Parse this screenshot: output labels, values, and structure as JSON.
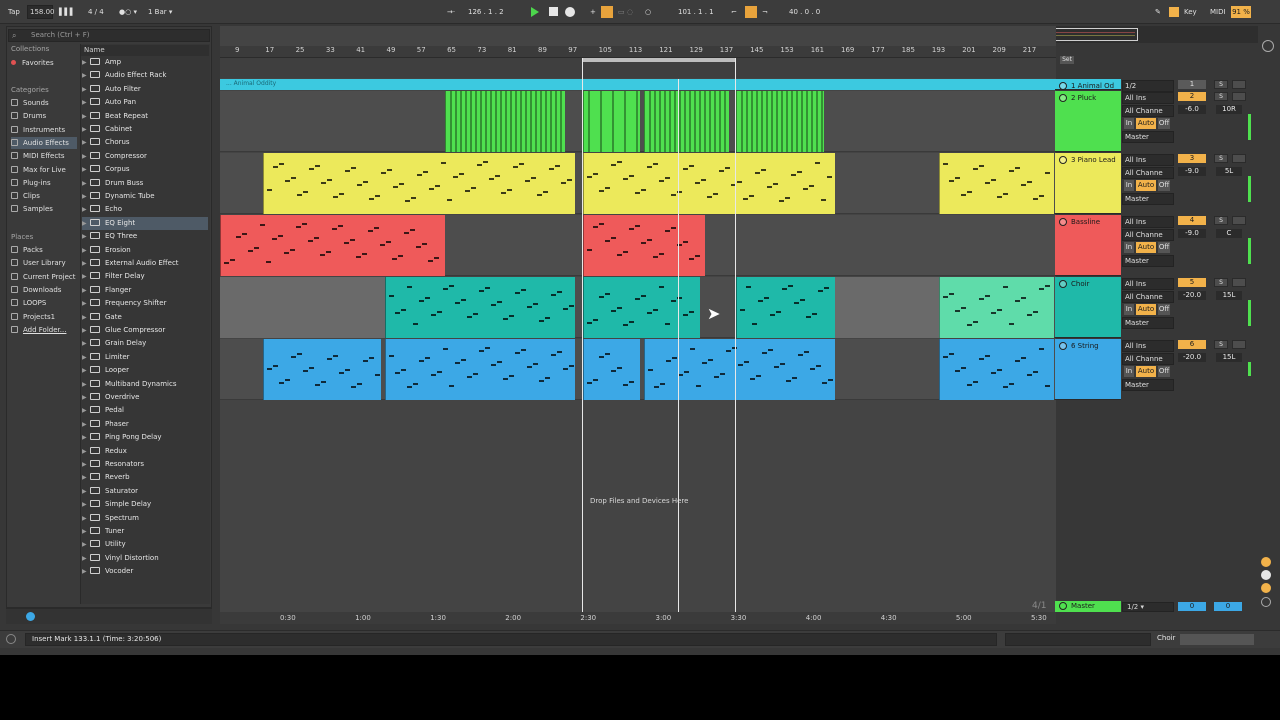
{
  "transport": {
    "tap": "Tap",
    "tempo": "158.00",
    "meter": "4 / 4",
    "quant": "1 Bar",
    "position": "126 .  1 .  2",
    "loop_start": "101 .  1 .  1",
    "loop_len": "40 .  0 .  0",
    "key": "Key",
    "midi": "MIDI",
    "cpu": "91 %"
  },
  "browser": {
    "search_placeholder": "Search (Ctrl + F)",
    "collections_header": "Collections",
    "favorites": "Favorites",
    "categories_header": "Categories",
    "categories": [
      "Sounds",
      "Drums",
      "Instruments",
      "Audio Effects",
      "MIDI Effects",
      "Max for Live",
      "Plug-ins",
      "Clips",
      "Samples"
    ],
    "places_header": "Places",
    "places": [
      "Packs",
      "User Library",
      "Current Project",
      "Downloads",
      "LOOPS",
      "Projects1",
      "Add Folder..."
    ],
    "name_header": "Name",
    "items": [
      "Amp",
      "Audio Effect Rack",
      "Auto Filter",
      "Auto Pan",
      "Beat Repeat",
      "Cabinet",
      "Chorus",
      "Compressor",
      "Corpus",
      "Drum Buss",
      "Dynamic Tube",
      "Echo",
      "EQ Eight",
      "EQ Three",
      "Erosion",
      "External Audio Effect",
      "Filter Delay",
      "Flanger",
      "Frequency Shifter",
      "Gate",
      "Glue Compressor",
      "Grain Delay",
      "Limiter",
      "Looper",
      "Multiband Dynamics",
      "Overdrive",
      "Pedal",
      "Phaser",
      "Ping Pong Delay",
      "Redux",
      "Resonators",
      "Reverb",
      "Saturator",
      "Simple Delay",
      "Spectrum",
      "Tuner",
      "Utility",
      "Vinyl Distortion",
      "Vocoder"
    ]
  },
  "ruler": {
    "bars": [
      "9",
      "17",
      "25",
      "33",
      "41",
      "49",
      "57",
      "65",
      "73",
      "81",
      "89",
      "97",
      "105",
      "113",
      "121",
      "129",
      "137",
      "145",
      "153",
      "161",
      "169",
      "177",
      "185",
      "193",
      "201",
      "209",
      "217"
    ],
    "times": [
      "0:30",
      "1:00",
      "1:30",
      "2:00",
      "2:30",
      "3:00",
      "3:30",
      "4:00",
      "4:30",
      "5:00",
      "5:30"
    ],
    "set_label": "Set"
  },
  "group_clip_label": "... Animal Oddity",
  "drop_hint": "Drop Files and Devices Here",
  "tracks": [
    {
      "name": "1 Animal Od",
      "io_in": "1/2",
      "num": "1",
      "vol": "",
      "pan": "",
      "color": "#3cc9e0"
    },
    {
      "name": "2 Pluck",
      "io_in": "All Ins",
      "io_ch": "All Channe",
      "io_out": "Master",
      "num": "2",
      "vol": "-6.0",
      "pan": "10R",
      "color": "#4fe04f"
    },
    {
      "name": "3 Piano Lead",
      "io_in": "All Ins",
      "io_ch": "All Channe",
      "io_out": "Master",
      "num": "3",
      "vol": "-9.0",
      "pan": "5L",
      "color": "#ece95b"
    },
    {
      "name": "Bassline",
      "io_in": "All Ins",
      "io_ch": "All Channe",
      "io_out": "Master",
      "num": "4",
      "vol": "-9.0",
      "pan": "C",
      "color": "#ef5a5a"
    },
    {
      "name": "Choir",
      "io_in": "All Ins",
      "io_ch": "All Channe",
      "io_out": "Master",
      "num": "5",
      "vol": "-20.0",
      "pan": "15L",
      "color": "#1fb9a9"
    },
    {
      "name": "6 String",
      "io_in": "All Ins",
      "io_ch": "All Channe",
      "io_out": "Master",
      "num": "6",
      "vol": "-20.0",
      "pan": "15L",
      "color": "#3ca8e6"
    }
  ],
  "io_labels": {
    "in": "In",
    "auto": "Auto",
    "off": "Off",
    "s": "S"
  },
  "master": {
    "name": "Master",
    "io": "1/2",
    "num": "0",
    "vol": "0",
    "position": "4/1"
  },
  "status": {
    "message": "Insert Mark 133.1.1 (Time: 3:20:506)",
    "track": "Choir"
  }
}
